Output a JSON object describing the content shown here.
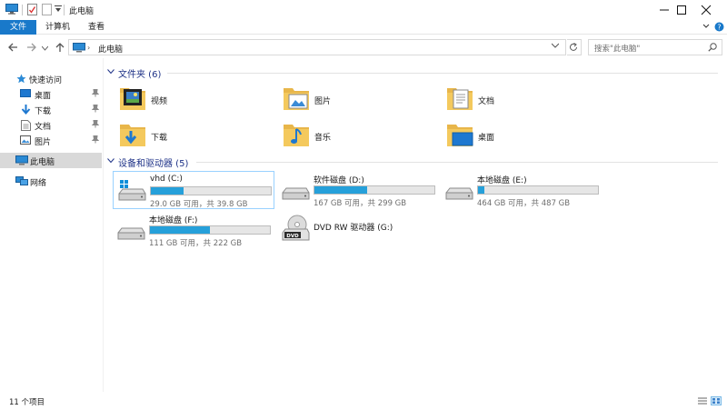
{
  "window": {
    "title": "此电脑"
  },
  "ribbon": {
    "tabs": [
      {
        "label": "文件"
      },
      {
        "label": "计算机"
      },
      {
        "label": "查看"
      }
    ]
  },
  "address": {
    "path": "此电脑"
  },
  "search": {
    "placeholder": "搜索\"此电脑\""
  },
  "nav": {
    "quick_access": "快速访问",
    "pinned": [
      {
        "label": "桌面",
        "icon": "desktop-icon"
      },
      {
        "label": "下载",
        "icon": "download-icon"
      },
      {
        "label": "文档",
        "icon": "document-icon"
      },
      {
        "label": "图片",
        "icon": "pictures-icon"
      }
    ],
    "this_pc": "此电脑",
    "network": "网络"
  },
  "folders_group": {
    "title": "文件夹 (6)",
    "items": [
      {
        "label": "视频",
        "icon": "videos-folder-icon"
      },
      {
        "label": "图片",
        "icon": "pictures-folder-icon"
      },
      {
        "label": "文档",
        "icon": "documents-folder-icon"
      },
      {
        "label": "下载",
        "icon": "downloads-folder-icon"
      },
      {
        "label": "音乐",
        "icon": "music-folder-icon"
      },
      {
        "label": "桌面",
        "icon": "desktop-folder-icon"
      }
    ]
  },
  "drives_group": {
    "title": "设备和驱动器 (5)",
    "items": [
      {
        "name": "vhd (C:)",
        "info": "29.0 GB 可用，共 39.8 GB",
        "used_fraction": 0.27
      },
      {
        "name": "软件磁盘 (D:)",
        "info": "167 GB 可用，共 299 GB",
        "used_fraction": 0.44
      },
      {
        "name": "本地磁盘 (E:)",
        "info": "464 GB 可用，共 487 GB",
        "used_fraction": 0.05
      },
      {
        "name": "本地磁盘 (F:)",
        "info": "111 GB 可用，共 222 GB",
        "used_fraction": 0.5
      },
      {
        "name": "DVD RW 驱动器 (G:)"
      }
    ]
  },
  "status": {
    "item_count": "11 个项目"
  },
  "colors": {
    "accent": "#1979ca",
    "usage_bar": "#26a0da",
    "group_title": "#1e3287",
    "folder": "#f4c95d"
  }
}
